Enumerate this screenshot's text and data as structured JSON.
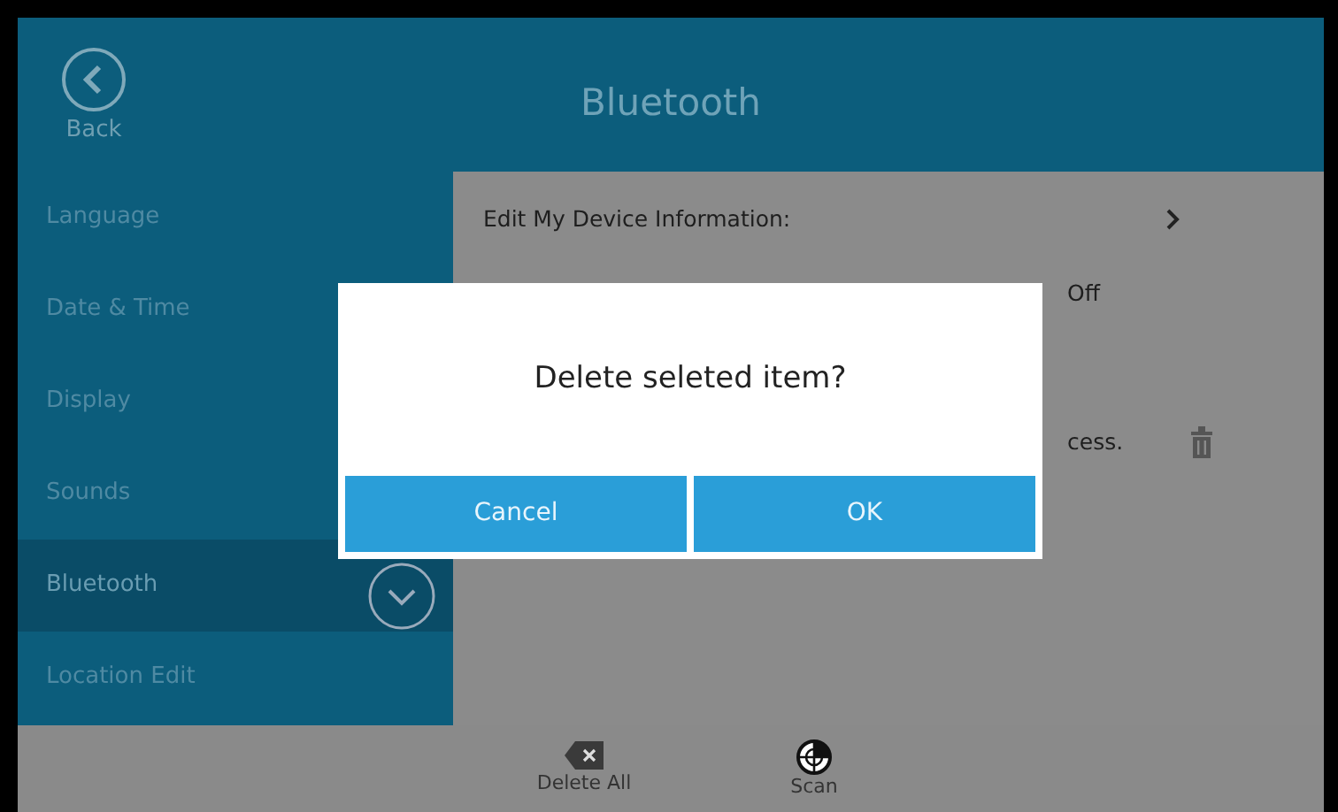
{
  "header": {
    "back_label": "Back",
    "title": "Bluetooth"
  },
  "sidebar": {
    "items": [
      {
        "label": "Language",
        "selected": false
      },
      {
        "label": "Date & Time",
        "selected": false
      },
      {
        "label": "Display",
        "selected": false
      },
      {
        "label": "Sounds",
        "selected": false
      },
      {
        "label": "Bluetooth",
        "selected": true
      },
      {
        "label": "Location Edit",
        "selected": false
      }
    ]
  },
  "content": {
    "rows": [
      {
        "kind": "link",
        "label": "Edit My Device Information:"
      },
      {
        "kind": "value",
        "label": "Off"
      },
      {
        "kind": "device",
        "label": "cess."
      }
    ]
  },
  "toolbar": [
    {
      "kind": "delete",
      "label": "Delete All"
    },
    {
      "kind": "scan",
      "label": "Scan"
    }
  ],
  "dialog": {
    "message": "Delete seleted item?",
    "buttons": [
      "Cancel",
      "OK"
    ]
  }
}
